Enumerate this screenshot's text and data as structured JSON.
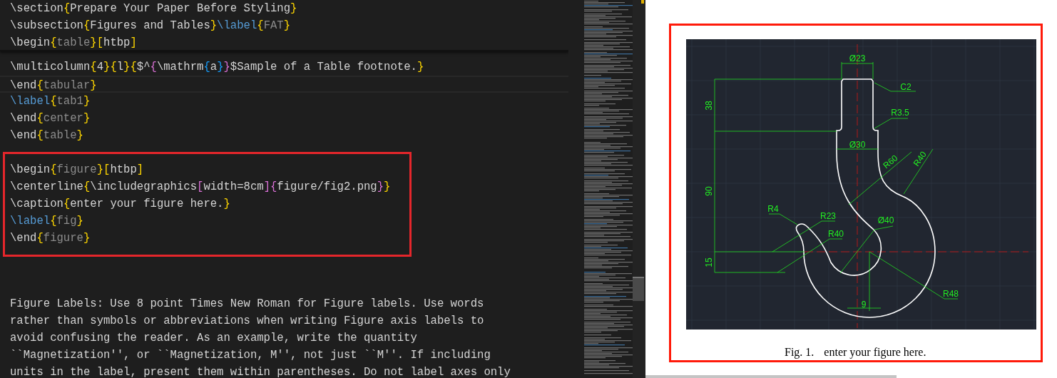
{
  "editor": {
    "sticky_lines": [
      {
        "tokens": [
          {
            "text": "\\section",
            "kind": "plain"
          },
          {
            "text": "{",
            "kind": "brace"
          },
          {
            "text": "Prepare Your Paper Before Styling",
            "kind": "plain"
          },
          {
            "text": "}",
            "kind": "brace"
          }
        ]
      },
      {
        "tokens": [
          {
            "text": "\\subsection",
            "kind": "plain"
          },
          {
            "text": "{",
            "kind": "brace"
          },
          {
            "text": "Figures and Tables",
            "kind": "plain"
          },
          {
            "text": "}",
            "kind": "brace"
          },
          {
            "text": "\\label",
            "kind": "keyword"
          },
          {
            "text": "{",
            "kind": "brace"
          },
          {
            "text": "FAT",
            "kind": "arg"
          },
          {
            "text": "}",
            "kind": "brace"
          }
        ]
      },
      {
        "tokens": [
          {
            "text": "\\begin",
            "kind": "plain"
          },
          {
            "text": "{",
            "kind": "brace"
          },
          {
            "text": "table",
            "kind": "arg"
          },
          {
            "text": "}",
            "kind": "brace"
          },
          {
            "text": "[",
            "kind": "brace"
          },
          {
            "text": "htbp",
            "kind": "plain"
          },
          {
            "text": "]",
            "kind": "brace"
          }
        ]
      }
    ],
    "lines": [
      {
        "current": false,
        "tokens": [
          {
            "text": "\\multicolumn",
            "kind": "plain"
          },
          {
            "text": "{",
            "kind": "brace"
          },
          {
            "text": "4",
            "kind": "plain"
          },
          {
            "text": "}",
            "kind": "brace"
          },
          {
            "text": "{",
            "kind": "brace"
          },
          {
            "text": "l",
            "kind": "plain"
          },
          {
            "text": "}",
            "kind": "brace"
          },
          {
            "text": "{",
            "kind": "brace"
          },
          {
            "text": "$^",
            "kind": "plain"
          },
          {
            "text": "{",
            "kind": "brace2"
          },
          {
            "text": "\\mathrm",
            "kind": "plain"
          },
          {
            "text": "{",
            "kind": "brace3"
          },
          {
            "text": "a",
            "kind": "plain"
          },
          {
            "text": "}",
            "kind": "brace3"
          },
          {
            "text": "}",
            "kind": "brace2"
          },
          {
            "text": "$Sample of a Table footnote.",
            "kind": "plain"
          },
          {
            "text": "}",
            "kind": "brace"
          }
        ]
      },
      {
        "current": true,
        "tokens": [
          {
            "text": "\\end",
            "kind": "plain"
          },
          {
            "text": "{",
            "kind": "brace"
          },
          {
            "text": "tabular",
            "kind": "arg"
          },
          {
            "text": "}",
            "kind": "brace"
          }
        ]
      },
      {
        "current": false,
        "tokens": [
          {
            "text": "\\label",
            "kind": "keyword"
          },
          {
            "text": "{",
            "kind": "brace"
          },
          {
            "text": "tab1",
            "kind": "arg"
          },
          {
            "text": "}",
            "kind": "brace"
          }
        ]
      },
      {
        "current": false,
        "tokens": [
          {
            "text": "\\end",
            "kind": "plain"
          },
          {
            "text": "{",
            "kind": "brace"
          },
          {
            "text": "center",
            "kind": "arg"
          },
          {
            "text": "}",
            "kind": "brace"
          }
        ]
      },
      {
        "current": false,
        "tokens": [
          {
            "text": "\\end",
            "kind": "plain"
          },
          {
            "text": "{",
            "kind": "brace"
          },
          {
            "text": "table",
            "kind": "arg"
          },
          {
            "text": "}",
            "kind": "brace"
          }
        ]
      }
    ],
    "boxed_lines": [
      {
        "current": false,
        "tokens": [
          {
            "text": "\\begin",
            "kind": "plain"
          },
          {
            "text": "{",
            "kind": "brace"
          },
          {
            "text": "figure",
            "kind": "arg"
          },
          {
            "text": "}",
            "kind": "brace"
          },
          {
            "text": "[",
            "kind": "brace"
          },
          {
            "text": "htbp",
            "kind": "plain"
          },
          {
            "text": "]",
            "kind": "brace"
          }
        ]
      },
      {
        "current": false,
        "tokens": [
          {
            "text": "\\centerline",
            "kind": "plain"
          },
          {
            "text": "{",
            "kind": "brace"
          },
          {
            "text": "\\includegraphics",
            "kind": "plain"
          },
          {
            "text": "[",
            "kind": "brace2"
          },
          {
            "text": "width=8cm",
            "kind": "plain"
          },
          {
            "text": "]",
            "kind": "brace2"
          },
          {
            "text": "{",
            "kind": "brace2"
          },
          {
            "text": "figure/fig2.png",
            "kind": "plain"
          },
          {
            "text": "}",
            "kind": "brace2"
          },
          {
            "text": "}",
            "kind": "brace"
          }
        ]
      },
      {
        "current": false,
        "tokens": [
          {
            "text": "\\caption",
            "kind": "plain"
          },
          {
            "text": "{",
            "kind": "brace"
          },
          {
            "text": "enter your figure here.",
            "kind": "plain"
          },
          {
            "text": "}",
            "kind": "brace"
          }
        ]
      },
      {
        "current": false,
        "tokens": [
          {
            "text": "\\label",
            "kind": "keyword"
          },
          {
            "text": "{",
            "kind": "brace"
          },
          {
            "text": "fig",
            "kind": "arg"
          },
          {
            "text": "}",
            "kind": "brace"
          }
        ]
      },
      {
        "current": false,
        "tokens": [
          {
            "text": "\\end",
            "kind": "plain"
          },
          {
            "text": "{",
            "kind": "brace"
          },
          {
            "text": "figure",
            "kind": "arg"
          },
          {
            "text": "}",
            "kind": "brace"
          }
        ]
      }
    ],
    "paragraph_lines": [
      {
        "current": false,
        "tokens": [
          {
            "text": "Figure Labels: Use 8 point Times New Roman for Figure labels. Use words",
            "kind": "plain"
          }
        ]
      },
      {
        "current": false,
        "tokens": [
          {
            "text": "rather than symbols or abbreviations when writing Figure axis labels to",
            "kind": "plain"
          }
        ]
      },
      {
        "current": false,
        "tokens": [
          {
            "text": "avoid confusing the reader. As an example, write the quantity",
            "kind": "plain"
          }
        ]
      },
      {
        "current": false,
        "tokens": [
          {
            "text": "``Magnetization'', or ``Magnetization, M'', not just ``M''. If including",
            "kind": "plain"
          }
        ]
      },
      {
        "current": false,
        "tokens": [
          {
            "text": "units in the label, present them within parentheses. Do not label axes only",
            "kind": "plain"
          }
        ]
      }
    ]
  },
  "preview": {
    "figure": {
      "labels": [
        "Ø23",
        "C2",
        "38",
        "R3.5",
        "Ø30",
        "R60",
        "R40",
        "90",
        "R4",
        "R23",
        "R40",
        "Ø40",
        "15",
        "R48",
        "9"
      ]
    },
    "caption": {
      "label": "Fig. 1.",
      "text": "enter your figure here."
    }
  }
}
